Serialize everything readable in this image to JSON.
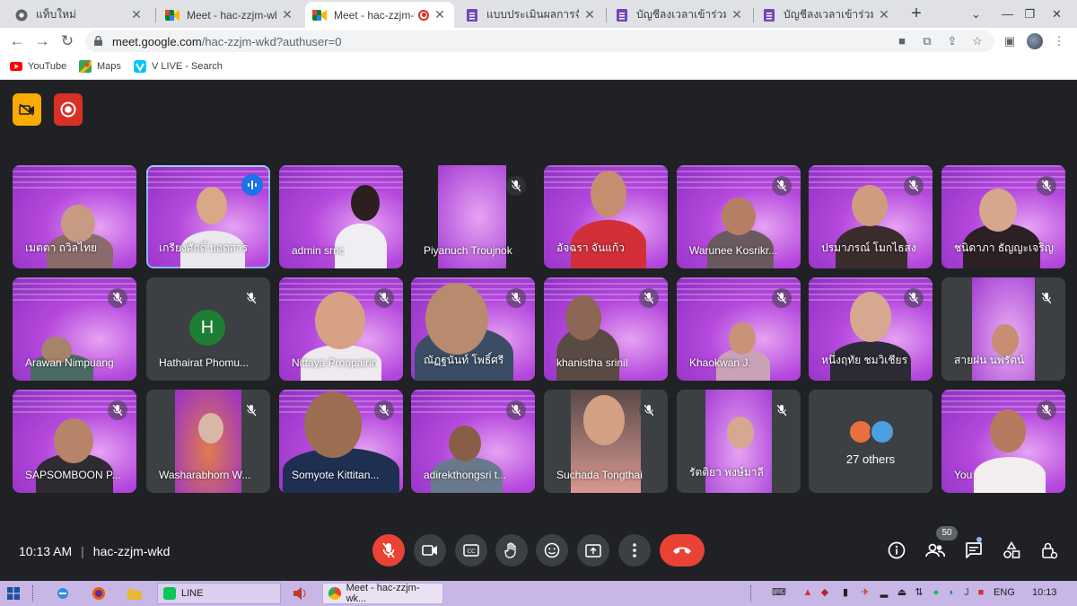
{
  "browser": {
    "tabs": [
      {
        "label": "แท็บใหม่",
        "icon": "chrome-icon"
      },
      {
        "label": "Meet - hac-zzjm-wkd",
        "icon": "meet-icon"
      },
      {
        "label": "Meet - hac-zzjm-wk",
        "icon": "meet-icon"
      },
      {
        "label": "แบบประเมินผลการจัดกิจกรรม",
        "icon": "forms-icon"
      },
      {
        "label": "บัญชีลงเวลาเข้าร่วมกิจกรรม",
        "icon": "forms-icon"
      },
      {
        "label": "บัญชีลงเวลาเข้าร่วมกิจกรรม",
        "icon": "forms-icon"
      }
    ],
    "url_host": "meet.google.com",
    "url_path": "/hac-zzjm-wkd?authuser=0",
    "bookmarks": [
      {
        "label": "YouTube",
        "icon": "youtube-icon"
      },
      {
        "label": "Maps",
        "icon": "maps-icon"
      },
      {
        "label": "V LIVE - Search",
        "icon": "vlive-icon"
      }
    ]
  },
  "meet": {
    "meeting_code": "hac-zzjm-wkd",
    "time": "10:13 AM",
    "participants": [
      {
        "name": "เมตตา ถวิลไทย",
        "bg": "slide",
        "muted": false
      },
      {
        "name": "เกรียงศักดิ์ ยอดสาร",
        "bg": "slide",
        "muted": false,
        "speaking": true
      },
      {
        "name": "admin srnc",
        "bg": "slide",
        "muted": false
      },
      {
        "name": "Piyanuch Troujnok",
        "bg": "slide",
        "muted": true
      },
      {
        "name": "อัจฉรา จันแก้ว",
        "bg": "slide",
        "muted": false
      },
      {
        "name": "Warunee Kosrikr...",
        "bg": "slide",
        "muted": true
      },
      {
        "name": "ปรมาภรณ์ โมกไธสง",
        "bg": "slide",
        "muted": true
      },
      {
        "name": "ชนิดาภา ธัญญะเจริญ",
        "bg": "slide",
        "muted": true
      },
      {
        "name": "Arawan Nimpuang",
        "bg": "slide",
        "muted": true
      },
      {
        "name": "Hathairat Phomu...",
        "bg": "plain",
        "muted": true,
        "initial": "H"
      },
      {
        "name": "Nittaya Pronpairin",
        "bg": "slide",
        "muted": true
      },
      {
        "name": "ณัฏฐนันท์ โพธิ์ศรี",
        "bg": "slide",
        "muted": true
      },
      {
        "name": "khanistha srinil",
        "bg": "slide",
        "muted": true
      },
      {
        "name": "Khaokwan J.",
        "bg": "slide",
        "muted": true
      },
      {
        "name": "หนึ่งฤทัย ชมวิเชียร",
        "bg": "slide",
        "muted": true
      },
      {
        "name": "สายฝน นพรัตน์",
        "bg": "slide",
        "muted": true
      },
      {
        "name": "SAPSOMBOON P...",
        "bg": "slide",
        "muted": true
      },
      {
        "name": "Washarabhorn W...",
        "bg": "slide",
        "muted": true
      },
      {
        "name": "Somyote Kittitan...",
        "bg": "slide",
        "muted": true
      },
      {
        "name": "adirekthongsri t...",
        "bg": "slide",
        "muted": true
      },
      {
        "name": "Suchada Tongthai",
        "bg": "slide",
        "muted": true
      },
      {
        "name": "รัตติยา พงษ์มาลี",
        "bg": "slide",
        "muted": true
      },
      {
        "name": "27 others",
        "bg": "others",
        "muted": false
      },
      {
        "name": "You",
        "bg": "slide",
        "muted": true
      }
    ],
    "people_count": "50"
  },
  "taskbar": {
    "items": [
      {
        "label": "LINE",
        "icon": "line-icon"
      },
      {
        "label": "Meet - hac-zzjm-wk...",
        "icon": "chrome-icon"
      }
    ],
    "lang": "ENG",
    "clock": "10:13"
  },
  "colors": {
    "meet_bg": "#202124",
    "end_call": "#ea4335",
    "tile_purple": "#b548dd",
    "speaker_blue": "#1a73e8",
    "taskbar": "#c7b6e6"
  }
}
